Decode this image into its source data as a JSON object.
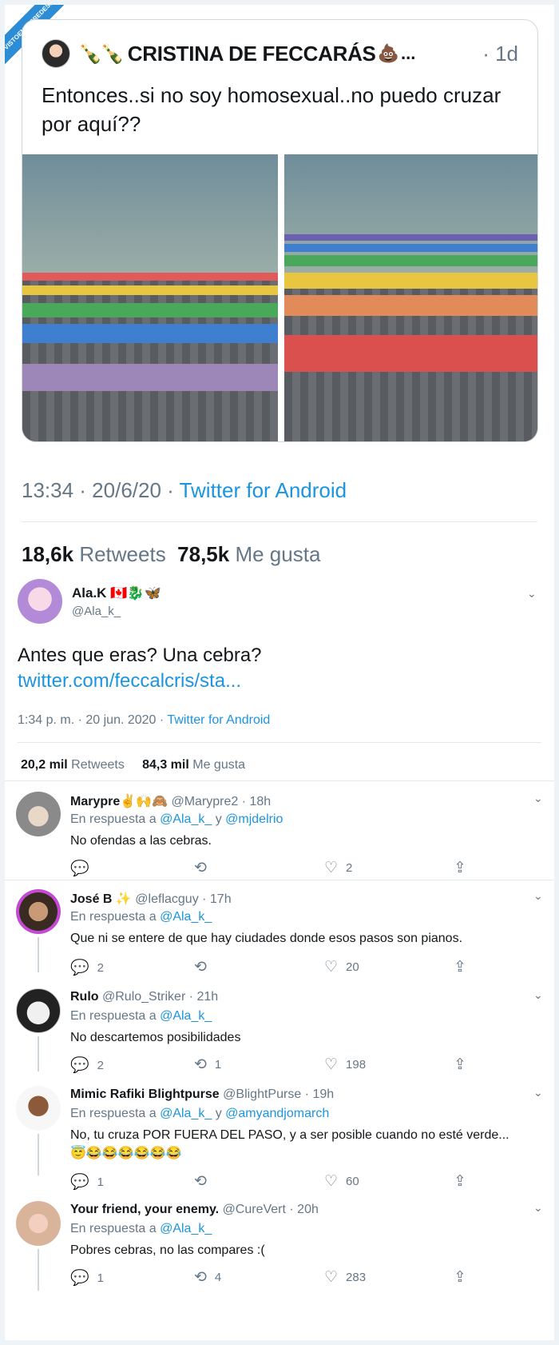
{
  "watermark": "VISTOENLASREDES.com",
  "quoted": {
    "name_emoji": "🍾🍾",
    "name": "CRISTINA DE FECCARÁS",
    "name_suffix_emoji": "💩",
    "name_ellipsis": "...",
    "time": "· 1d",
    "text": "Entonces..si no soy homosexual..no puedo cruzar por aquí??"
  },
  "quoted_meta": {
    "time_date": "13:34 · 20/6/20 · ",
    "source": "Twitter for Android",
    "retweets_count": "18,6k",
    "retweets_label": "Retweets",
    "likes_count": "78,5k",
    "likes_label": "Me gusta"
  },
  "main_tweet": {
    "name": "Ala.K",
    "name_emoji": "🇨🇦🐉🦋",
    "handle": "@Ala_k_",
    "text": "Antes que eras? Una cebra?",
    "link": "twitter.com/feccalcris/sta...",
    "time_date": "1:34 p. m. · 20 jun. 2020 · ",
    "source": "Twitter for Android",
    "retweets_count": "20,2 mil",
    "retweets_label": "Retweets",
    "likes_count": "84,3 mil",
    "likes_label": "Me gusta"
  },
  "icons": {
    "chevron": "chevron-down-icon",
    "reply": "reply-icon",
    "retweet": "retweet-icon",
    "like": "heart-icon",
    "share": "share-icon"
  },
  "replies": [
    {
      "name": "Marypre",
      "name_emoji": "✌🙌🙈",
      "handle_time": "@Marypre2 · 18h",
      "reply_prefix": "En respuesta a ",
      "reply_to_1": "@Ala_k_",
      "reply_joiner": " y ",
      "reply_to_2": "@mjdelrio",
      "body": "No ofendas a las cebras.",
      "replies": "",
      "retweets": "",
      "likes": "2"
    },
    {
      "name": "José B",
      "name_emoji": "✨",
      "handle_time": "@leflacguy · 17h",
      "reply_prefix": "En respuesta a ",
      "reply_to_1": "@Ala_k_",
      "body": "Que ni se entere de que hay ciudades donde esos pasos son pianos.",
      "replies": "2",
      "retweets": "",
      "likes": "20"
    },
    {
      "name": "Rulo",
      "handle_time": "@Rulo_Striker · 21h",
      "reply_prefix": "En respuesta a ",
      "reply_to_1": "@Ala_k_",
      "body": "No descartemos posibilidades",
      "replies": "2",
      "retweets": "1",
      "likes": "198"
    },
    {
      "name": "Mimic Rafiki Blightpurse",
      "handle_time": "@BlightPurse · 19h",
      "reply_prefix": "En respuesta a ",
      "reply_to_1": "@Ala_k_",
      "reply_joiner": " y ",
      "reply_to_2": "@amyandjomarch",
      "body": "No, tu cruza POR FUERA DEL PASO, y a ser posible cuando no esté verde... 😇😂😂😂😂😂😂",
      "replies": "1",
      "retweets": "",
      "likes": "60"
    },
    {
      "name": "Your friend, your enemy.",
      "handle_time": "@CureVert · 20h",
      "reply_prefix": "En respuesta a ",
      "reply_to_1": "@Ala_k_",
      "body": "Pobres cebras, no las compares :(",
      "replies": "1",
      "retweets": "4",
      "likes": "283"
    }
  ]
}
